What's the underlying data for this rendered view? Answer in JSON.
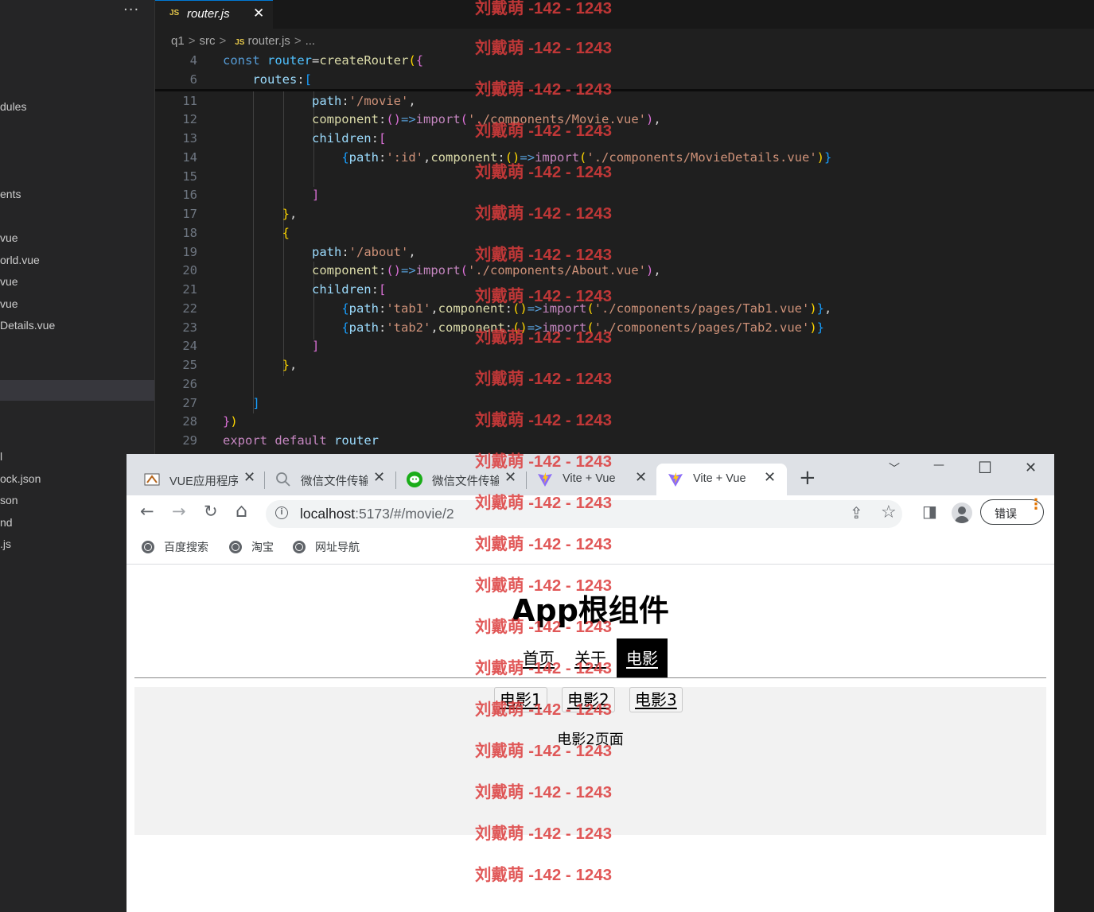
{
  "explorer": {
    "more_label": "···",
    "items": [
      "dules",
      "ents",
      "vue",
      "orld.vue",
      "vue",
      "vue",
      "Details.vue",
      "l",
      "ock.json",
      "son",
      "nd",
      ".js"
    ]
  },
  "editor": {
    "tab": {
      "badge": "JS",
      "name": "router.js",
      "close": "✕"
    },
    "breadcrumb": {
      "folder1": "q1",
      "folder2": "src",
      "badge": "JS",
      "file": "router.js",
      "more": "..."
    },
    "lines": [
      {
        "n": "4",
        "html": "<span style='color:#569cd6'>const</span> <span style='color:#4fc1ff'>router</span>=<span style='color:#dcdcaa'>createRouter</span><span style='color:#ffd700'>(</span><span style='color:#da70d6'>{</span>"
      },
      {
        "n": "6",
        "html": "    <span style='color:#9cdcfe'>routes</span>:<span style='color:#179fff'>[</span>"
      },
      {
        "n": "11",
        "html": "            <span style='color:#9cdcfe'>path</span>:<span style='color:#ce9178'>'/movie'</span>,"
      },
      {
        "n": "12",
        "html": "            <span style='color:#dcdcaa'>component</span>:<span style='color:#da70d6'>()</span><span style='color:#569cd6'>=&gt;</span><span style='color:#c586c0'>import</span><span style='color:#da70d6'>(</span><span style='color:#ce9178'>'./components/Movie.vue'</span><span style='color:#da70d6'>)</span>,"
      },
      {
        "n": "13",
        "html": "            <span style='color:#9cdcfe'>children</span>:<span style='color:#da70d6'>[</span>"
      },
      {
        "n": "14",
        "html": "                <span style='color:#179fff'>{</span><span style='color:#9cdcfe'>path</span>:<span style='color:#ce9178'>':id'</span>,<span style='color:#dcdcaa'>component</span>:<span style='color:#ffd700'>()</span><span style='color:#569cd6'>=&gt;</span><span style='color:#c586c0'>import</span><span style='color:#ffd700'>(</span><span style='color:#ce9178'>'./components/MovieDetails.vue'</span><span style='color:#ffd700'>)</span><span style='color:#179fff'>}</span>"
      },
      {
        "n": "15",
        "html": ""
      },
      {
        "n": "16",
        "html": "            <span style='color:#da70d6'>]</span>"
      },
      {
        "n": "17",
        "html": "        <span style='color:#ffd700'>}</span>,"
      },
      {
        "n": "18",
        "html": "        <span style='color:#ffd700'>{</span>"
      },
      {
        "n": "19",
        "html": "            <span style='color:#9cdcfe'>path</span>:<span style='color:#ce9178'>'/about'</span>,"
      },
      {
        "n": "20",
        "html": "            <span style='color:#dcdcaa'>component</span>:<span style='color:#da70d6'>()</span><span style='color:#569cd6'>=&gt;</span><span style='color:#c586c0'>import</span><span style='color:#da70d6'>(</span><span style='color:#ce9178'>'./components/About.vue'</span><span style='color:#da70d6'>)</span>,"
      },
      {
        "n": "21",
        "html": "            <span style='color:#9cdcfe'>children</span>:<span style='color:#da70d6'>[</span>"
      },
      {
        "n": "22",
        "html": "                <span style='color:#179fff'>{</span><span style='color:#9cdcfe'>path</span>:<span style='color:#ce9178'>'tab1'</span>,<span style='color:#dcdcaa'>component</span>:<span style='color:#ffd700'>()</span><span style='color:#569cd6'>=&gt;</span><span style='color:#c586c0'>import</span><span style='color:#ffd700'>(</span><span style='color:#ce9178'>'./components/pages/Tab1.vue'</span><span style='color:#ffd700'>)</span><span style='color:#179fff'>}</span>,"
      },
      {
        "n": "23",
        "html": "                <span style='color:#179fff'>{</span><span style='color:#9cdcfe'>path</span>:<span style='color:#ce9178'>'tab2'</span>,<span style='color:#dcdcaa'>component</span>:<span style='color:#ffd700'>()</span><span style='color:#569cd6'>=&gt;</span><span style='color:#c586c0'>import</span><span style='color:#ffd700'>(</span><span style='color:#ce9178'>'./components/pages/Tab2.vue'</span><span style='color:#ffd700'>)</span><span style='color:#179fff'>}</span>"
      },
      {
        "n": "24",
        "html": "            <span style='color:#da70d6'>]</span>"
      },
      {
        "n": "25",
        "html": "        <span style='color:#ffd700'>}</span>,"
      },
      {
        "n": "26",
        "html": ""
      },
      {
        "n": "27",
        "html": "    <span style='color:#179fff'>]</span>"
      },
      {
        "n": "28",
        "html": "<span style='color:#da70d6'>}</span><span style='color:#ffd700'>)</span>"
      },
      {
        "n": "29",
        "html": "<span style='color:#c586c0'>export</span> <span style='color:#c586c0'>default</span> <span style='color:#9cdcfe'>router</span>"
      }
    ]
  },
  "browser": {
    "tabs": [
      {
        "title": "VUE应用程序",
        "close": "✕"
      },
      {
        "title": "微信文件传输",
        "close": "✕"
      },
      {
        "title": "微信文件传输",
        "close": "✕"
      },
      {
        "title": "Vite + Vue",
        "close": "✕"
      },
      {
        "title": "Vite + Vue",
        "close": "✕"
      }
    ],
    "new_tab": "+",
    "window": {
      "dropdown": "﹀",
      "minimize": "—",
      "maximize": "☐",
      "close": "✕"
    },
    "toolbar": {
      "back": "←",
      "forward": "→",
      "reload": "↻",
      "home": "⌂",
      "share": "⇪",
      "star": "☆",
      "sidepanel": "◨"
    },
    "url": {
      "info": "i",
      "host": "localhost",
      "path": ":5173/#/movie/2"
    },
    "error_button": "错误",
    "menu_dots": "⋮",
    "bookmarks": [
      "百度搜索",
      "淘宝",
      "网址导航"
    ]
  },
  "page": {
    "title": "App根组件",
    "nav": [
      "首页",
      "关于",
      "电影"
    ],
    "movie_buttons": [
      "电影1",
      "电影2",
      "电影3"
    ],
    "movie_content": "电影2页面"
  },
  "watermark": "刘戴萌 -142 - 1243"
}
